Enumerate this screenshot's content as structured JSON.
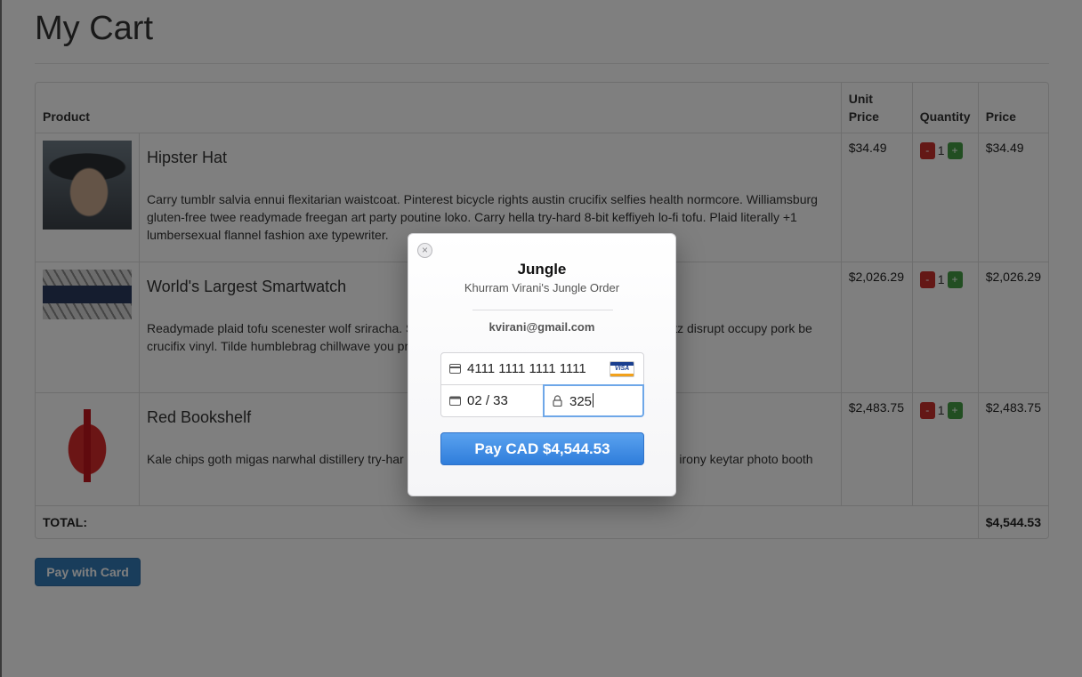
{
  "page": {
    "title": "My Cart"
  },
  "table": {
    "headers": {
      "product": "Product",
      "unit_price": "Unit\nPrice",
      "quantity": "Quantity",
      "price": "Price"
    },
    "rows": [
      {
        "name": "Hipster Hat",
        "description": "Carry tumblr salvia ennui flexitarian waistcoat. Pinterest bicycle rights austin crucifix selfies health normcore. Williamsburg gluten-free twee readymade freegan art party poutine loko. Carry hella try-hard 8-bit keffiyeh lo-fi tofu. Plaid literally +1 lumbersexual flannel fashion axe typewriter.",
        "unit_price": "$34.49",
        "quantity": "1",
        "price": "$34.49",
        "image_icon": "hat-photo"
      },
      {
        "name": "World's Largest Smartwatch",
        "description": "Readymade plaid tofu scenester wolf sriracha. Skateboard yuccie venmo. 8-bit skateboard schlitz disrupt occupy pork be crucifix vinyl. Tilde humblebrag chillwave you probably haven't hea",
        "unit_price": "$2,026.29",
        "quantity": "1",
        "price": "$2,026.29",
        "image_icon": "smartwatch-photo"
      },
      {
        "name": "Red Bookshelf",
        "description": "Kale chips goth migas narwhal distillery try-har h. Polaroid selvage farm-to-table. Chia twee loko irony keytar photo booth",
        "unit_price": "$2,483.75",
        "quantity": "1",
        "price": "$2,483.75",
        "image_icon": "bookshelf-photo"
      }
    ],
    "minus_label": "-",
    "plus_label": "+",
    "total_label": "TOTAL:",
    "total_value": "$4,544.53"
  },
  "pay_with_card_label": "Pay with Card",
  "checkout_modal": {
    "title": "Jungle",
    "subtitle": "Khurram Virani's Jungle Order",
    "email": "kvirani@gmail.com",
    "card_number": "4111 1111 1111 1111",
    "card_brand": "VISA",
    "expiry": "02 / 33",
    "cvc": "325",
    "pay_button_label": "Pay CAD $4,544.53",
    "close_symbol": "×",
    "colors": {
      "pay_button": "#3a88e2",
      "focus_border": "#6ea7e8"
    }
  }
}
